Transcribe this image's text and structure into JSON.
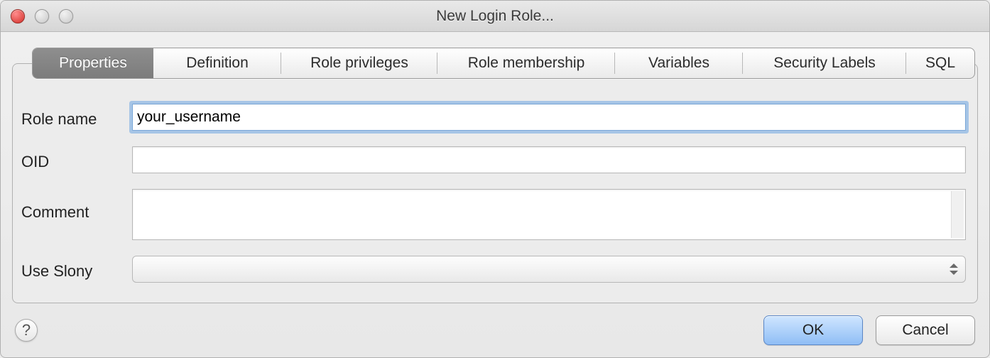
{
  "window": {
    "title": "New Login Role..."
  },
  "tabs": {
    "properties": "Properties",
    "definition": "Definition",
    "role_privileges": "Role privileges",
    "role_membership": "Role membership",
    "variables": "Variables",
    "security_labels": "Security Labels",
    "sql": "SQL",
    "active": "properties"
  },
  "form": {
    "role_name": {
      "label": "Role name",
      "value": "your_username"
    },
    "oid": {
      "label": "OID",
      "value": ""
    },
    "comment": {
      "label": "Comment",
      "value": ""
    },
    "use_slony": {
      "label": "Use Slony",
      "value": ""
    }
  },
  "buttons": {
    "ok": "OK",
    "cancel": "Cancel",
    "help": "?"
  }
}
